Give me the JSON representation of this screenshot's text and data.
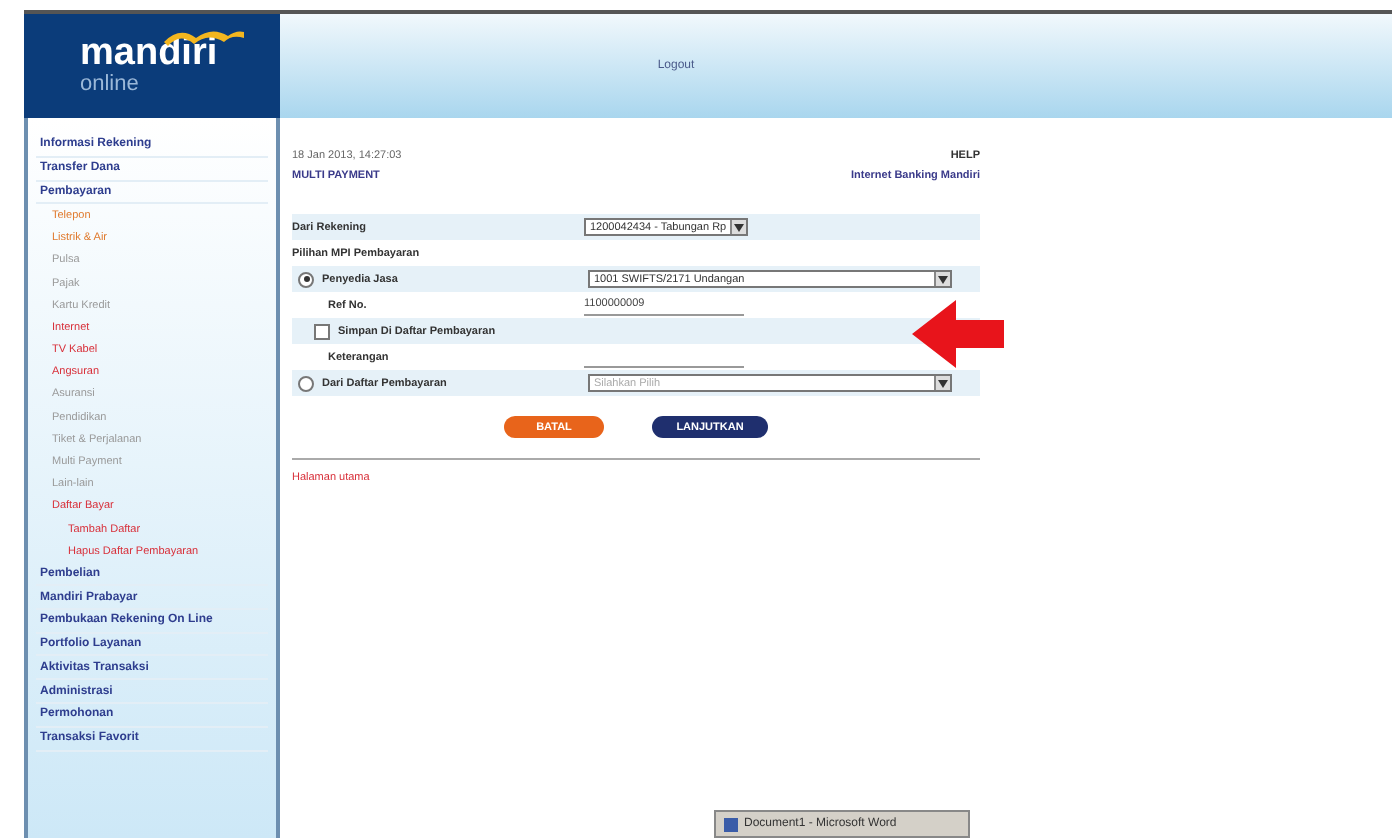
{
  "header": {
    "logo_word": "mandiri",
    "logo_sub": "online",
    "logout": "Logout"
  },
  "sidebar": {
    "items": [
      {
        "label": "Informasi Rekening"
      },
      {
        "label": "Transfer Dana"
      },
      {
        "label": "Pembayaran",
        "children": [
          {
            "label": "Telepon",
            "color": "#e07a2e"
          },
          {
            "label": "Listrik & Air",
            "color": "#e07a2e"
          },
          {
            "label": "Pulsa",
            "color": "#9a9a9a"
          },
          {
            "label": "Pajak",
            "color": "#9a9a9a"
          },
          {
            "label": "Kartu Kredit",
            "color": "#9a9a9a"
          },
          {
            "label": "Internet",
            "color": "#d8303a"
          },
          {
            "label": "TV Kabel",
            "color": "#d8303a"
          },
          {
            "label": "Angsuran",
            "color": "#d8303a"
          },
          {
            "label": "Asuransi",
            "color": "#9a9a9a"
          },
          {
            "label": "Pendidikan",
            "color": "#9a9a9a"
          },
          {
            "label": "Tiket & Perjalanan",
            "color": "#9a9a9a"
          },
          {
            "label": "Multi Payment",
            "color": "#9a9a9a"
          },
          {
            "label": "Lain-lain",
            "color": "#9a9a9a"
          },
          {
            "label": "Daftar Bayar",
            "color": "#d8303a",
            "children": [
              {
                "label": "Tambah Daftar",
                "color": "#d8303a"
              },
              {
                "label": "Hapus Daftar Pembayaran",
                "color": "#d8303a"
              }
            ]
          }
        ]
      },
      {
        "label": "Pembelian"
      },
      {
        "label": "Mandiri Prabayar"
      },
      {
        "label": "Pembukaan Rekening On Line"
      },
      {
        "label": "Portfolio Layanan"
      },
      {
        "label": "Aktivitas Transaksi"
      },
      {
        "label": "Administrasi"
      },
      {
        "label": "Permohonan"
      },
      {
        "label": "Transaksi Favorit"
      }
    ]
  },
  "page": {
    "datetime": "18 Jan 2013, 14:27:03",
    "help": "HELP",
    "title": "MULTI PAYMENT",
    "brand": "Internet Banking Mandiri"
  },
  "form": {
    "rows": [
      {
        "kind": "select",
        "label": "Dari Rekening",
        "value": "1200042434 - Tabungan Rp",
        "shaded": true
      },
      {
        "kind": "heading",
        "label": "Pilihan MPI Pembayaran"
      },
      {
        "kind": "radio-select",
        "label": "Penyedia Jasa",
        "selected": true,
        "value": "1001 SWIFTS/2171 Undangan",
        "shaded": true
      },
      {
        "kind": "text",
        "label": "Ref No.",
        "value": "1100000009"
      },
      {
        "kind": "checkbox",
        "label": "Simpan Di Daftar Pembayaran",
        "checked": false,
        "shaded": true
      },
      {
        "kind": "text",
        "label": "Keterangan"
      },
      {
        "kind": "radio-select",
        "label": "Dari Daftar Pembayaran",
        "selected": false,
        "placeholder": "Silahkan Pilih",
        "shaded": true
      }
    ],
    "buttons": [
      {
        "label": "BATAL",
        "kind": "cancel"
      },
      {
        "label": "LANJUTKAN",
        "kind": "submit"
      }
    ],
    "footer_link": "Halaman utama"
  },
  "taskbar": {
    "label": "Document1 - Microsoft Word"
  }
}
